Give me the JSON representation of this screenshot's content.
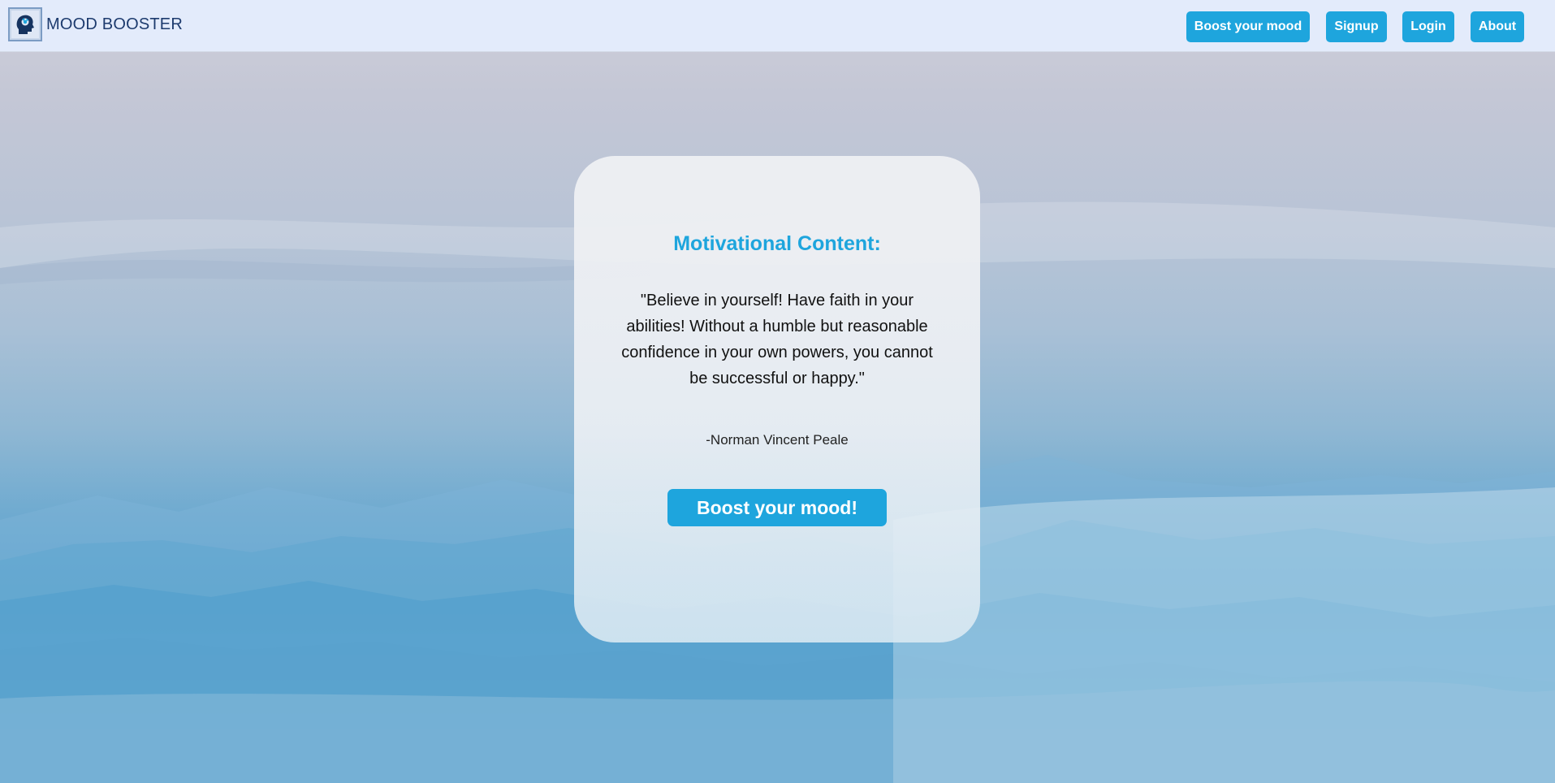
{
  "brand": {
    "logo_icon": "head-brain-icon",
    "name": "MOOD BOOSTER"
  },
  "nav": {
    "items": [
      {
        "label": "Boost your mood"
      },
      {
        "label": "Signup"
      },
      {
        "label": "Login"
      },
      {
        "label": "About"
      }
    ]
  },
  "card": {
    "title": "Motivational Content:",
    "quote": "\"Believe in yourself! Have faith in your abilities! Without a humble but reasonable confidence in your own powers, you cannot be successful or happy.\"",
    "author": "-Norman Vincent Peale",
    "button_label": "Boost your mood!"
  },
  "colors": {
    "accent": "#1ea5dd",
    "navbar_bg": "#e3ebfb",
    "brand_text": "#1d3b6e"
  }
}
